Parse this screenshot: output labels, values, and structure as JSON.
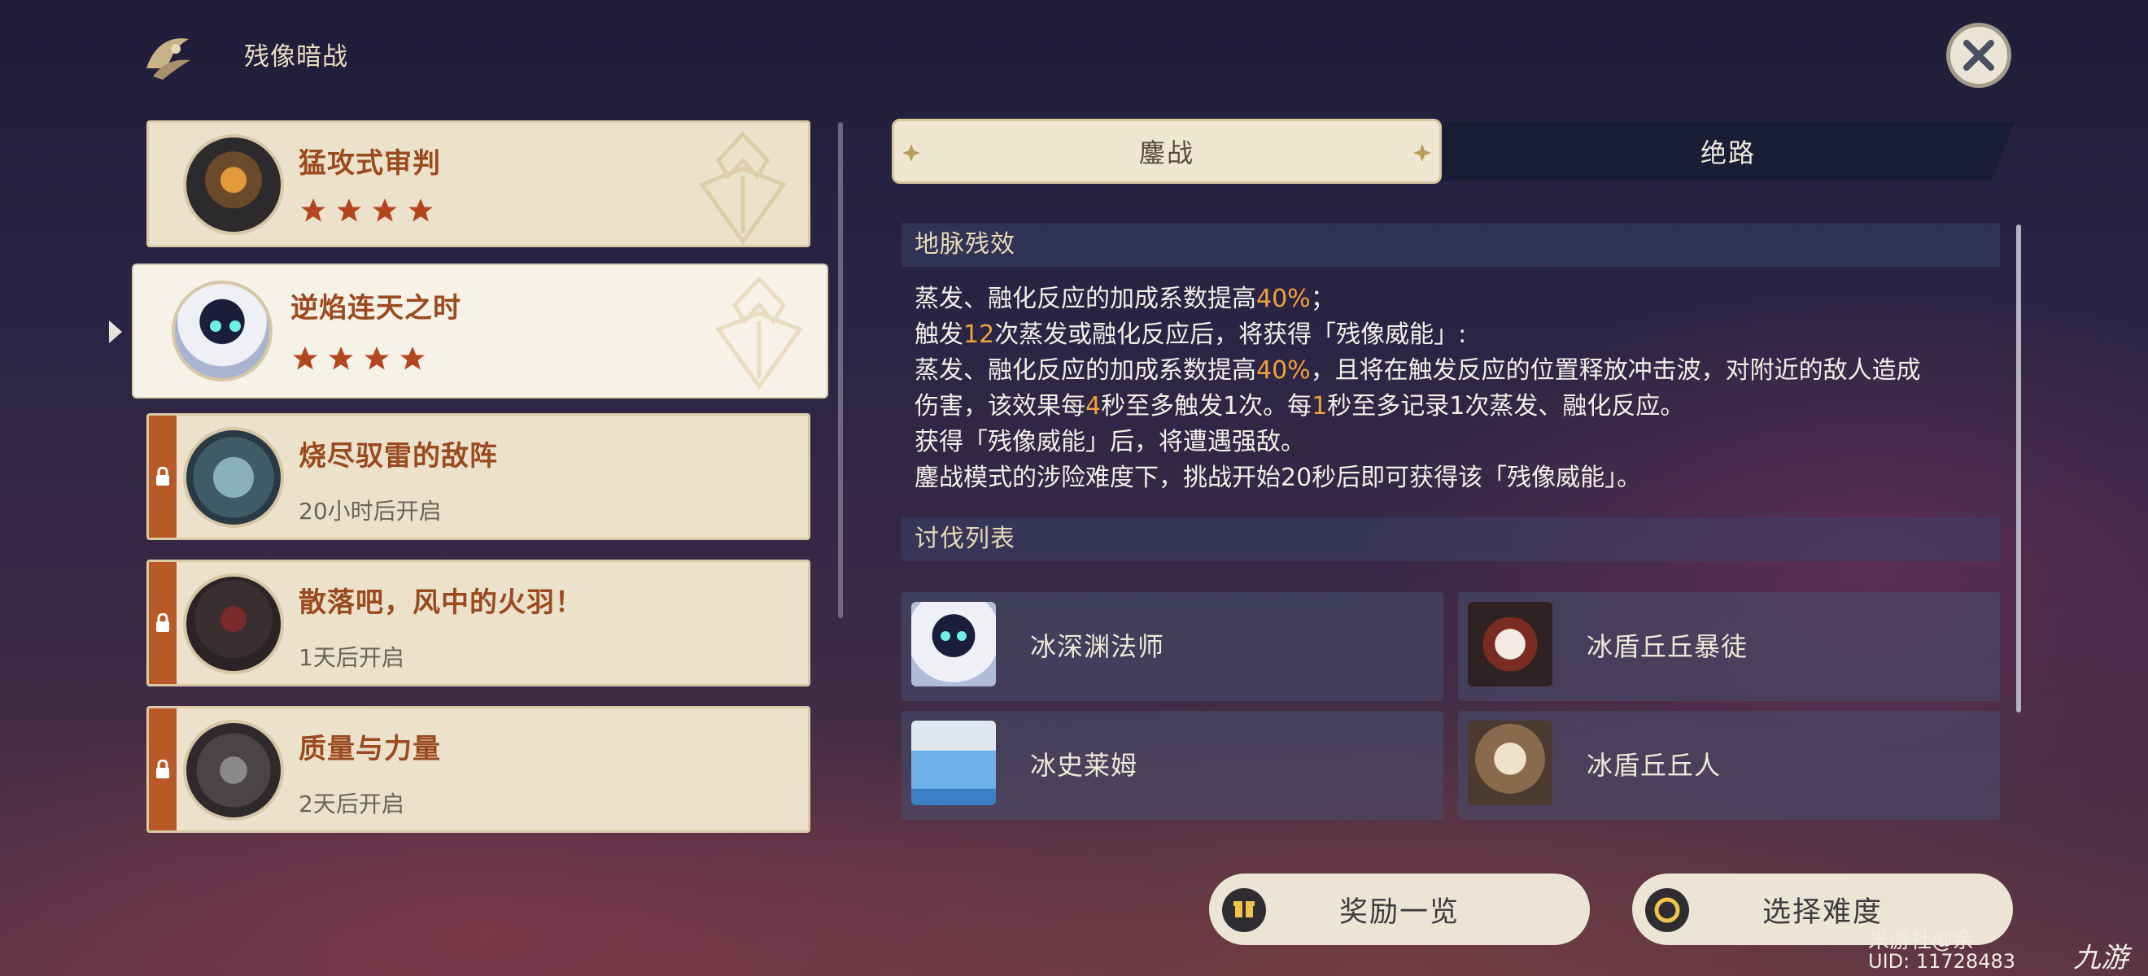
{
  "header": {
    "title": "残像暗战",
    "logo_icon": "event-emblem-icon",
    "close_icon": "close-icon"
  },
  "challenges": [
    {
      "name": "猛攻式审判",
      "stars": 4,
      "locked": false,
      "selected": false
    },
    {
      "name": "逆焰连天之时",
      "stars": 4,
      "locked": false,
      "selected": true
    },
    {
      "name": "烧尽驭雷的敌阵",
      "status": "20小时后开启",
      "locked": true,
      "selected": false
    },
    {
      "name": "散落吧，风中的火羽！",
      "status": "1天后开启",
      "locked": true,
      "selected": false
    },
    {
      "name": "质量与力量",
      "status": "2天后开启",
      "locked": true,
      "selected": false
    }
  ],
  "tabs": {
    "active": "鏖战",
    "inactive": "绝路"
  },
  "sections": {
    "effects_title": "地脉残效",
    "enemies_title": "讨伐列表"
  },
  "description": {
    "l1_a": "蒸发、融化反应的加成系数提高",
    "l1_b": "40%",
    "l1_c": "；",
    "l2_a": "触发",
    "l2_b": "12",
    "l2_c": "次蒸发或融化反应后，将获得「残像威能」:",
    "l3_a": "蒸发、融化反应的加成系数提高",
    "l3_b": "40%",
    "l3_c": "，且将在触发反应的位置释放冲击波，对附近的敌人造成",
    "l4_a": "伤害，该效果每",
    "l4_b": "4",
    "l4_c": "秒至多触发1次。每",
    "l4_d": "1",
    "l4_e": "秒至多记录1次蒸发、融化反应。",
    "l5": "获得「残像威能」后，将遭遇强敌。",
    "l6": "鏖战模式的涉险难度下，挑战开始20秒后即可获得该「残像威能」。"
  },
  "enemies": [
    {
      "name": "冰深渊法师"
    },
    {
      "name": "冰盾丘丘暴徒"
    },
    {
      "name": "冰史莱姆"
    },
    {
      "name": "冰盾丘丘人"
    }
  ],
  "buttons": {
    "rewards": "奖励一览",
    "difficulty": "选择难度"
  },
  "watermark": {
    "line1": "米游社@余",
    "line2": "UID: 11728483",
    "brand": "九游"
  },
  "colors": {
    "accent_orange": "#f0a23a",
    "name_brown": "#9a4a1e",
    "lock_bar": "#b85a27",
    "card_bg": "#ece2cc"
  }
}
